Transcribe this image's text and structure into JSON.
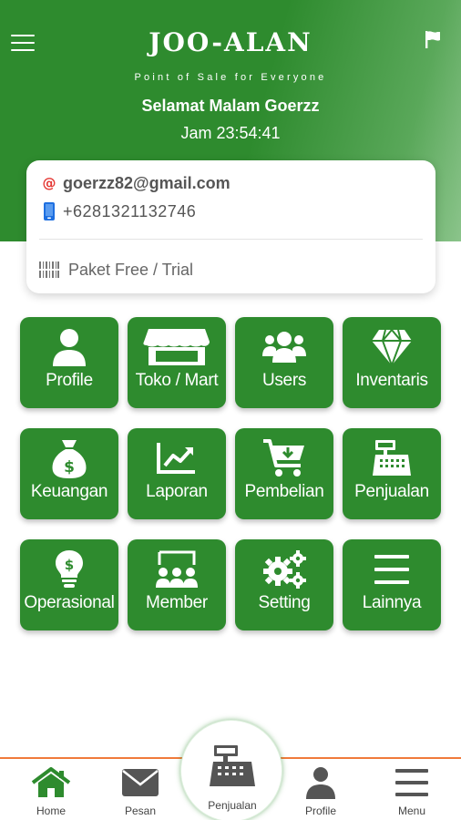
{
  "header": {
    "app_title": "JOO-ALAN",
    "app_subtitle": "Point of Sale for Everyone",
    "greeting": "Selamat Malam Goerzz",
    "clock": "Jam 23:54:41"
  },
  "account": {
    "email_icon_glyph": "@",
    "email": "goerzz82@gmail.com",
    "phone": "+6281321132746",
    "plan": "Paket Free / Trial"
  },
  "menu": [
    {
      "label": "Profile",
      "icon": "user-icon"
    },
    {
      "label": "Toko / Mart",
      "icon": "store-icon"
    },
    {
      "label": "Users",
      "icon": "users-icon"
    },
    {
      "label": "Inventaris",
      "icon": "diamond-icon"
    },
    {
      "label": "Keuangan",
      "icon": "money-bag-icon"
    },
    {
      "label": "Laporan",
      "icon": "chart-icon"
    },
    {
      "label": "Pembelian",
      "icon": "cart-icon"
    },
    {
      "label": "Penjualan",
      "icon": "cash-register-icon"
    },
    {
      "label": "Operasional",
      "icon": "lightbulb-icon"
    },
    {
      "label": "Member",
      "icon": "members-icon"
    },
    {
      "label": "Setting",
      "icon": "gears-icon"
    },
    {
      "label": "Lainnya",
      "icon": "list-icon"
    }
  ],
  "bottom_nav": {
    "home": "Home",
    "pesan": "Pesan",
    "penjualan": "Penjualan",
    "profile": "Profile",
    "menu": "Menu"
  },
  "colors": {
    "primary_green": "#2e8b2e",
    "nav_accent": "#f07a3a",
    "email_icon": "#e53935",
    "phone_icon": "#1e6fe0"
  }
}
